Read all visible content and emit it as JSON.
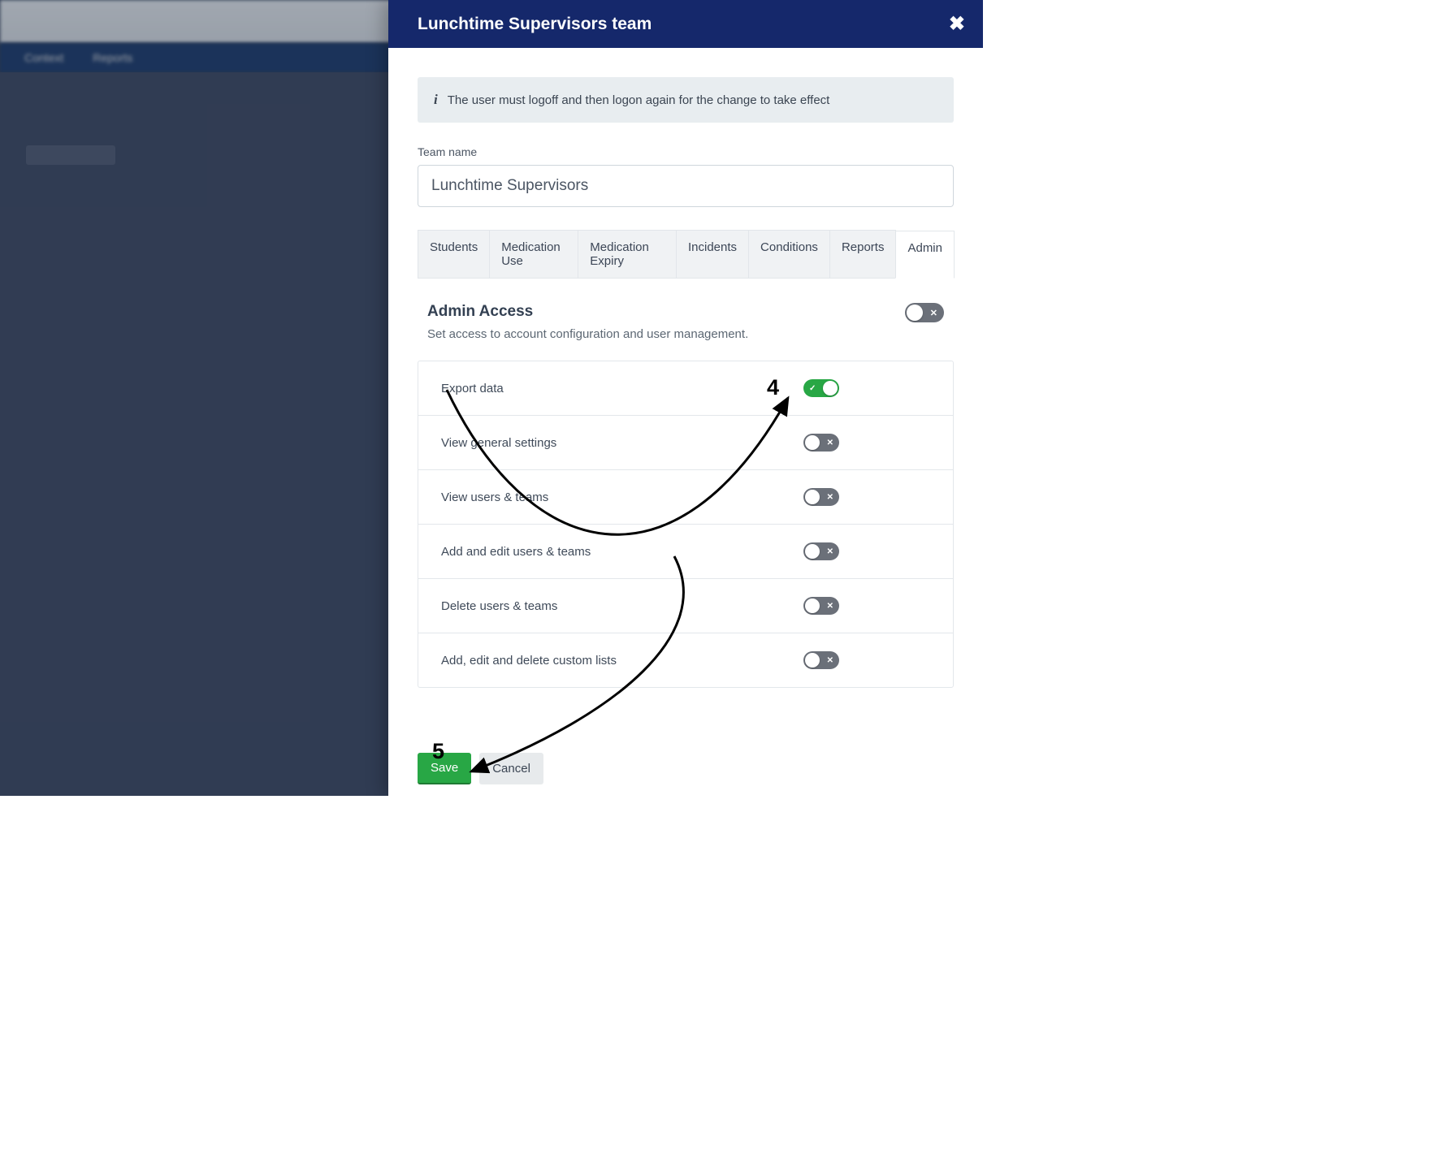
{
  "backdrop": {
    "nav_items": [
      "",
      "Context",
      "Reports"
    ]
  },
  "panel": {
    "title": "Lunchtime Supervisors team",
    "info_message": "The user must logoff and then logon again for the change to take effect",
    "team_name_label": "Team name",
    "team_name_value": "Lunchtime Supervisors",
    "tabs": [
      {
        "label": "Students",
        "active": false
      },
      {
        "label": "Medication Use",
        "active": false
      },
      {
        "label": "Medication Expiry",
        "active": false
      },
      {
        "label": "Incidents",
        "active": false
      },
      {
        "label": "Conditions",
        "active": false
      },
      {
        "label": "Reports",
        "active": false
      },
      {
        "label": "Admin",
        "active": true
      }
    ],
    "section": {
      "title": "Admin Access",
      "description": "Set access to account configuration and user management.",
      "master_toggle": false
    },
    "permissions": [
      {
        "label": "Export data",
        "enabled": true
      },
      {
        "label": "View general settings",
        "enabled": false
      },
      {
        "label": "View users & teams",
        "enabled": false
      },
      {
        "label": "Add and edit users & teams",
        "enabled": false
      },
      {
        "label": "Delete users & teams",
        "enabled": false
      },
      {
        "label": "Add, edit and delete custom lists",
        "enabled": false
      }
    ],
    "footer": {
      "save_label": "Save",
      "cancel_label": "Cancel"
    }
  },
  "annotations": {
    "num4": "4",
    "num5": "5"
  }
}
